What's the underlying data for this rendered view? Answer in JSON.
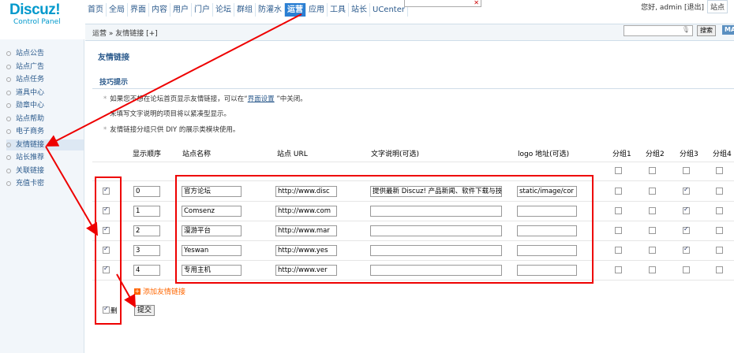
{
  "header": {
    "logo": "Discuz!",
    "logo_sub": "Control Panel",
    "nav": [
      "首页",
      "全局",
      "界面",
      "内容",
      "用户",
      "门户",
      "论坛",
      "群组",
      "防灌水",
      "运营",
      "应用",
      "工具",
      "站长",
      "UCenter"
    ],
    "nav_active_index": 9,
    "user_text": "您好, admin [退出]",
    "site_button": "站点"
  },
  "subbar": {
    "breadcrumb": "运营 » 友情链接  [+]",
    "search_button": "搜索",
    "ma_button": "MA"
  },
  "sidebar": {
    "items": [
      "站点公告",
      "站点广告",
      "站点任务",
      "道具中心",
      "勋章中心",
      "站点帮助",
      "电子商务",
      "友情链接",
      "站长推荐",
      "关联链接",
      "充值卡密"
    ],
    "active_index": 7
  },
  "main": {
    "title": "友情链接",
    "tips_title": "技巧提示",
    "tips": [
      {
        "text": "如果您不想在论坛首页显示友情链接，可以在“",
        "link": "界面设置",
        "after": " ”中关闭。"
      },
      {
        "text": "未填写文字说明的项目将以紧凑型显示。",
        "link": "",
        "after": ""
      },
      {
        "text": "友情链接分组只供 DIY 的展示类模块使用。",
        "link": "",
        "after": ""
      }
    ],
    "columns": [
      "显示顺序",
      "站点名称",
      "站点 URL",
      "文字说明(可选)",
      "logo 地址(可选)",
      "分组1",
      "分组2",
      "分组3",
      "分组4"
    ],
    "header_groups": [
      false,
      false,
      false,
      false
    ],
    "rows": [
      {
        "checked": true,
        "order": "0",
        "name": "官方论坛",
        "url": "http://www.disc",
        "desc": "提供最新 Discuz! 产品新闻、软件下载与技",
        "logo": "static/image/cor",
        "groups": [
          false,
          false,
          true,
          false
        ]
      },
      {
        "checked": true,
        "order": "1",
        "name": "Comsenz",
        "url": "http://www.com",
        "desc": "",
        "logo": "",
        "groups": [
          false,
          false,
          true,
          false
        ]
      },
      {
        "checked": true,
        "order": "2",
        "name": "漫游平台",
        "url": "http://www.mar",
        "desc": "",
        "logo": "",
        "groups": [
          false,
          false,
          true,
          false
        ]
      },
      {
        "checked": true,
        "order": "3",
        "name": "Yeswan",
        "url": "http://www.yes",
        "desc": "",
        "logo": "",
        "groups": [
          false,
          false,
          true,
          false
        ]
      },
      {
        "checked": true,
        "order": "4",
        "name": "专用主机",
        "url": "http://www.ver",
        "desc": "",
        "logo": "",
        "groups": [
          false,
          false,
          false,
          false
        ]
      }
    ],
    "add_link": "添加友情链接",
    "delete_label": "删",
    "submit": "提交"
  },
  "colors": {
    "accent": "#2b7fd3",
    "link": "#2b5a8c",
    "annotation": "#e00000",
    "add_link": "#ff6600"
  }
}
